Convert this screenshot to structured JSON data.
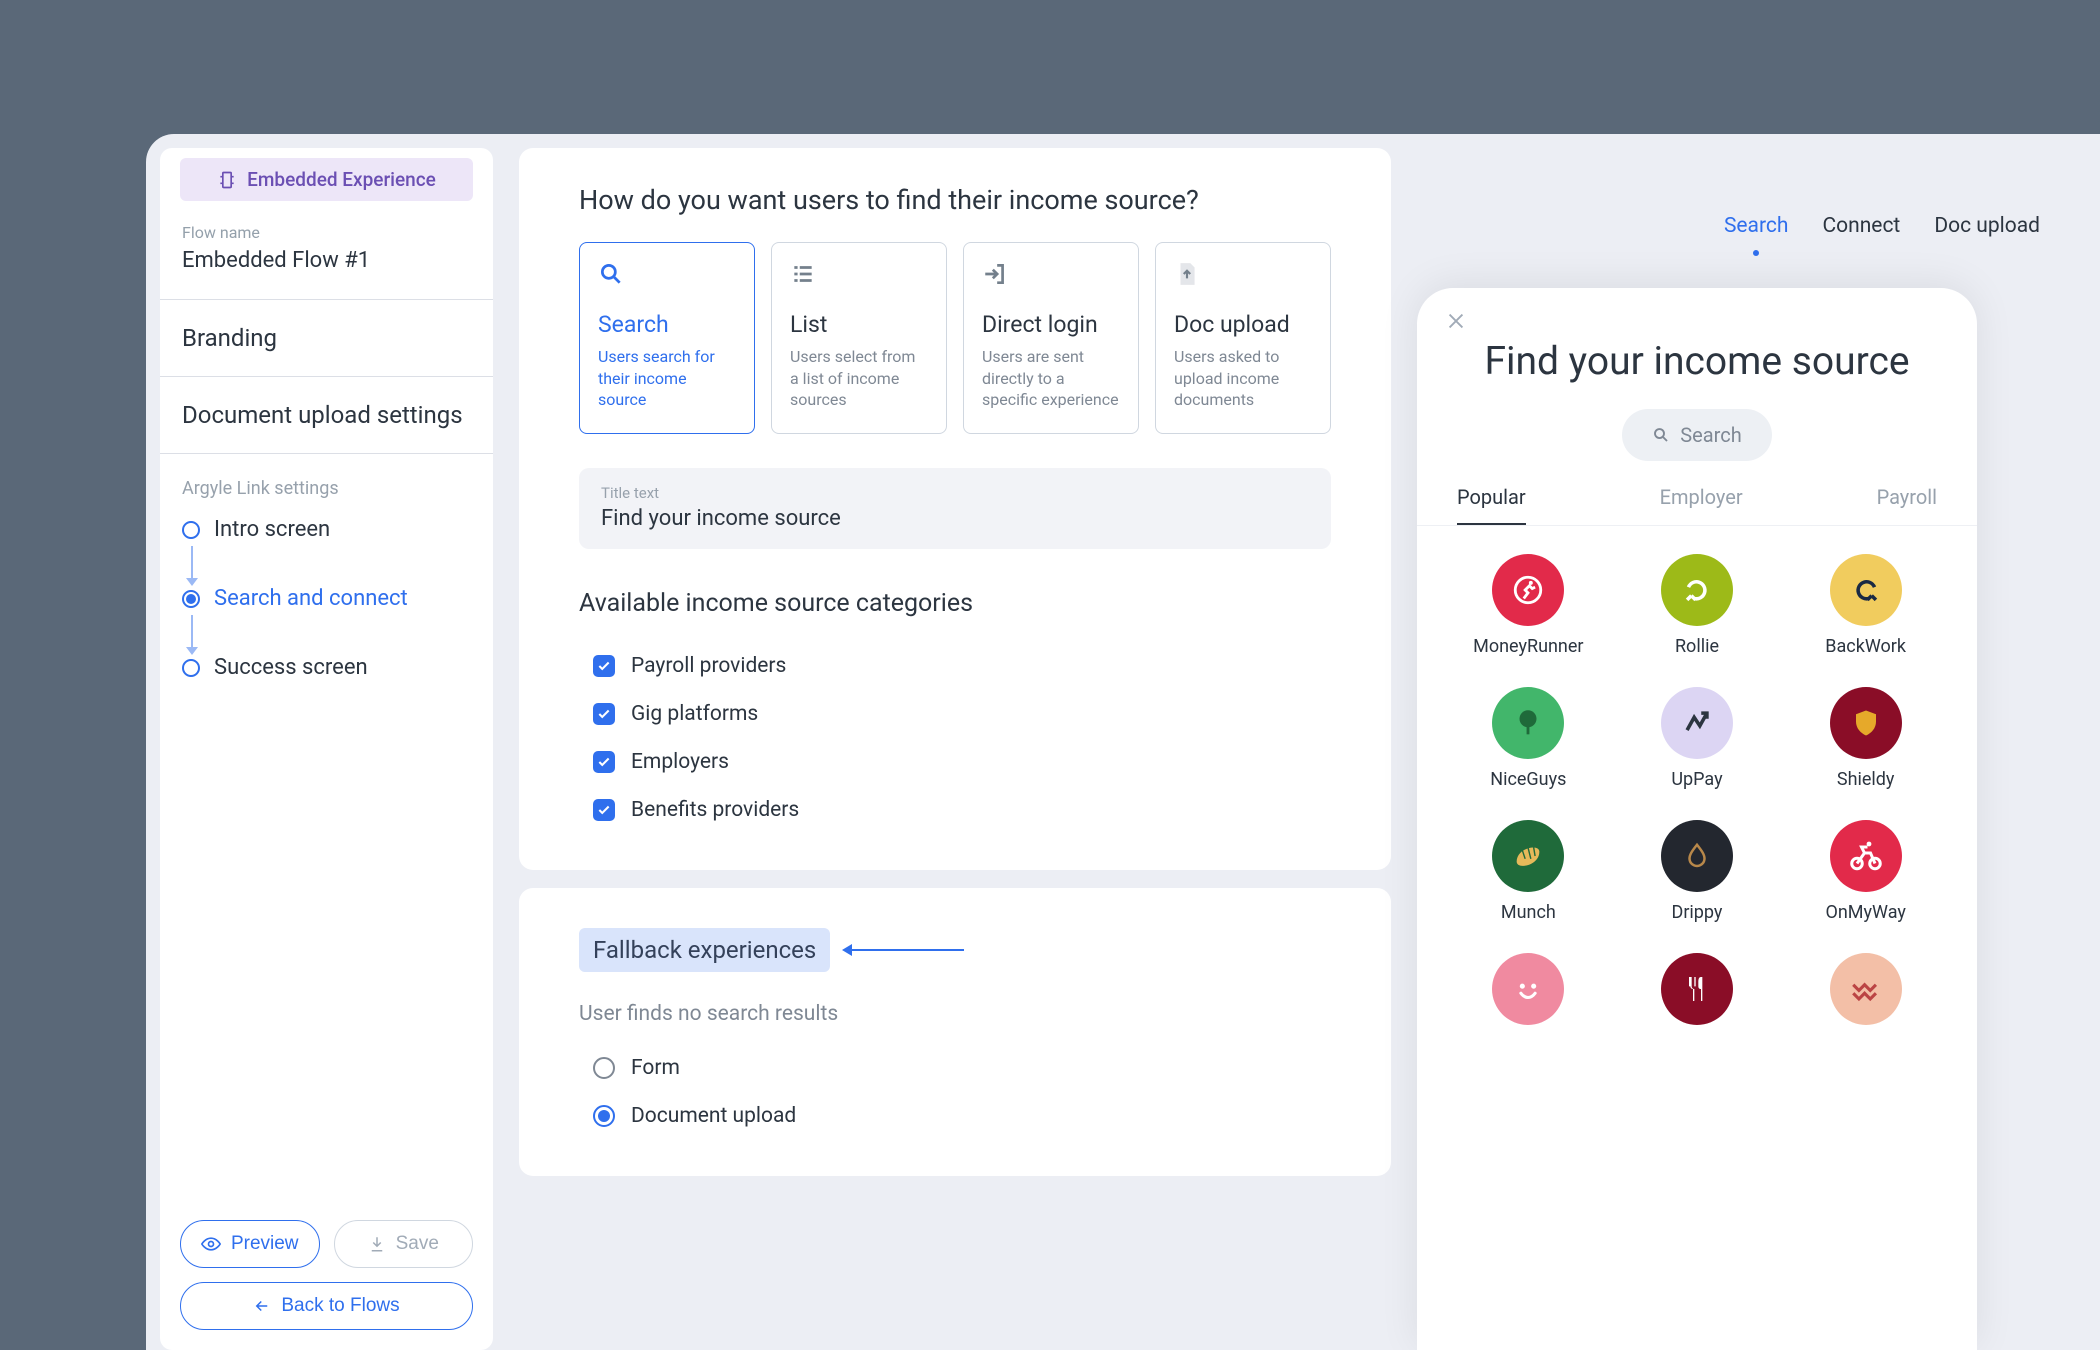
{
  "sidebar": {
    "banner": "Embedded Experience",
    "flow_name_label": "Flow name",
    "flow_name_value": "Embedded Flow #1",
    "nav": {
      "branding": "Branding",
      "doc_upload_settings": "Document upload settings"
    },
    "settings_label": "Argyle Link settings",
    "steps": {
      "intro": "Intro screen",
      "search_connect": "Search and connect",
      "success": "Success screen"
    },
    "footer": {
      "preview": "Preview",
      "save": "Save",
      "back_to_flows": "Back to Flows"
    }
  },
  "main": {
    "question": "How do you want users to find their income source?",
    "options": [
      {
        "title": "Search",
        "desc": "Users search for their income source",
        "selected": true
      },
      {
        "title": "List",
        "desc": "Users select from a list of income sources",
        "selected": false
      },
      {
        "title": "Direct login",
        "desc": "Users are sent directly to a specific experience",
        "selected": false
      },
      {
        "title": "Doc upload",
        "desc": "Users asked to upload income documents",
        "selected": false
      }
    ],
    "title_input": {
      "label": "Title text",
      "value": "Find your income source"
    },
    "categories_heading": "Available income source categories",
    "categories": [
      {
        "label": "Payroll providers",
        "checked": true
      },
      {
        "label": "Gig platforms",
        "checked": true
      },
      {
        "label": "Employers",
        "checked": true
      },
      {
        "label": "Benefits providers",
        "checked": true
      }
    ],
    "fallback": {
      "heading": "Fallback experiences",
      "sub": "User finds no search results",
      "options": [
        {
          "label": "Form",
          "selected": false
        },
        {
          "label": "Document upload",
          "selected": true
        }
      ]
    }
  },
  "preview": {
    "tabs": [
      {
        "label": "Search",
        "active": true
      },
      {
        "label": "Connect",
        "active": false
      },
      {
        "label": "Doc upload",
        "active": false
      }
    ],
    "phone": {
      "title": "Find your income source",
      "search_placeholder": "Search",
      "tabs": [
        {
          "label": "Popular",
          "active": true
        },
        {
          "label": "Employer",
          "active": false
        },
        {
          "label": "Payroll",
          "active": false
        }
      ],
      "sources": [
        {
          "name": "MoneyRunner",
          "bg": "#e22a4a",
          "icon": "runner"
        },
        {
          "name": "Rollie",
          "bg": "#9dba18",
          "icon": "swirl"
        },
        {
          "name": "BackWork",
          "bg": "#f1cc5e",
          "icon": "back"
        },
        {
          "name": "NiceGuys",
          "bg": "#42b66b",
          "icon": "tree"
        },
        {
          "name": "UpPay",
          "bg": "#dcd5f3",
          "icon": "up",
          "fg": "#2c3540"
        },
        {
          "name": "Shieldy",
          "bg": "#8a0d27",
          "icon": "shield",
          "fg": "#e6a92a"
        },
        {
          "name": "Munch",
          "bg": "#1f6a3a",
          "icon": "croissant",
          "fg": "#e6b95a"
        },
        {
          "name": "Drippy",
          "bg": "#23272f",
          "icon": "drop",
          "fg": "#b8884a"
        },
        {
          "name": "OnMyWay",
          "bg": "#e22a4a",
          "icon": "bike"
        },
        {
          "name": "",
          "bg": "#f08aa0",
          "icon": "smile"
        },
        {
          "name": "",
          "bg": "#8a0d27",
          "icon": "fork"
        },
        {
          "name": "",
          "bg": "#f3bfa7",
          "icon": "wave",
          "fg": "#b44"
        }
      ]
    }
  }
}
